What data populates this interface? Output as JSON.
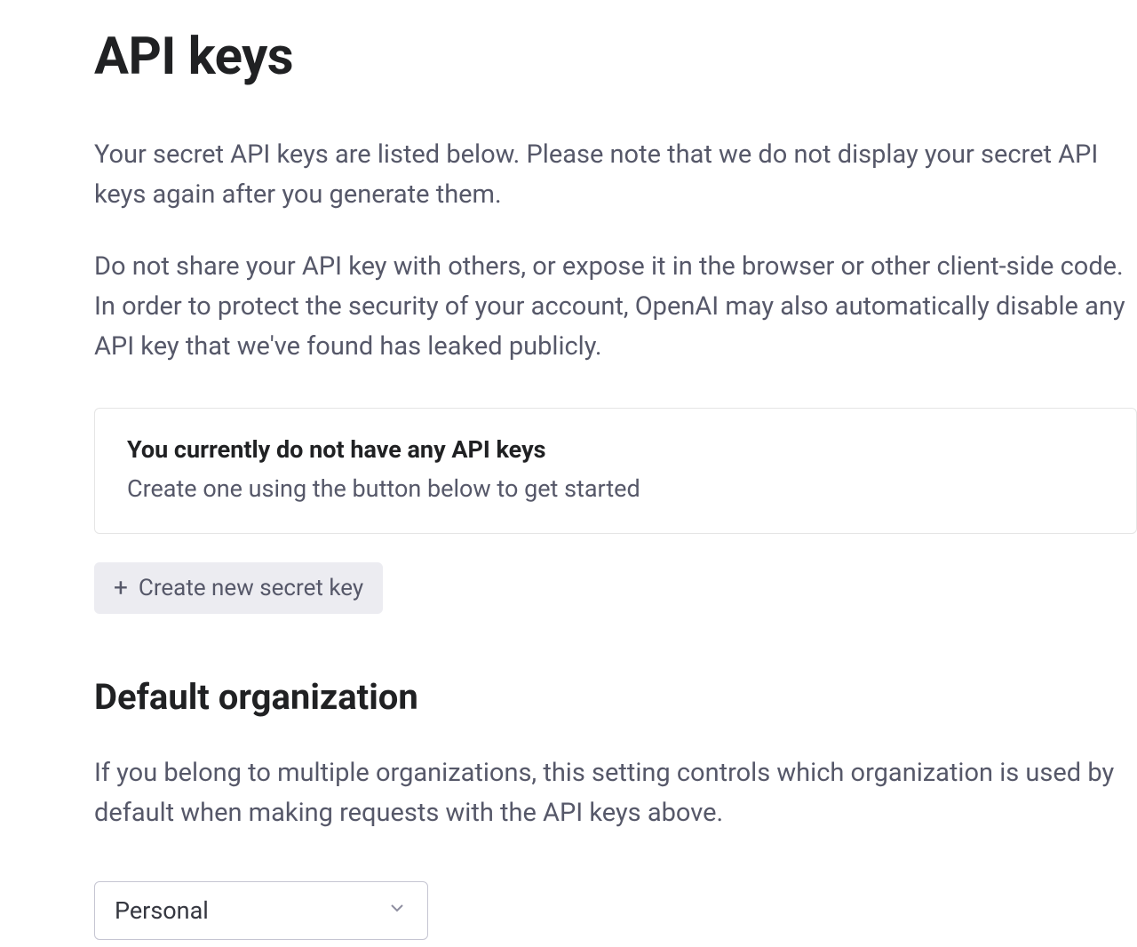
{
  "page": {
    "title": "API keys",
    "intro_p1": "Your secret API keys are listed below. Please note that we do not display your secret API keys again after you generate them.",
    "intro_p2": "Do not share your API key with others, or expose it in the browser or other client-side code. In order to protect the security of your account, OpenAI may also automatically disable any API key that we've found has leaked publicly."
  },
  "empty_state": {
    "title": "You currently do not have any API keys",
    "subtitle": "Create one using the button below to get started"
  },
  "buttons": {
    "create_key": "Create new secret key"
  },
  "org_section": {
    "title": "Default organization",
    "description": "If you belong to multiple organizations, this setting controls which organization is used by default when making requests with the API keys above.",
    "selected": "Personal"
  }
}
